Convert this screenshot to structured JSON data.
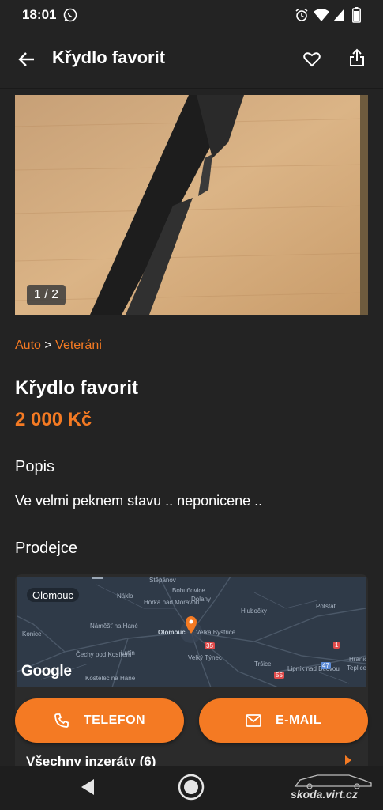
{
  "status_bar": {
    "time": "18:01",
    "battery": "85"
  },
  "app_bar": {
    "title": "Křydlo favorit"
  },
  "gallery": {
    "counter": "1 / 2"
  },
  "breadcrumb": {
    "first": "Auto",
    "separator": ">",
    "second": "Veteráni"
  },
  "ad": {
    "title": "Křydlo favorit",
    "price": "2 000 Kč"
  },
  "description": {
    "heading": "Popis",
    "text": "Ve velmi peknem stavu .. neponicene .."
  },
  "seller": {
    "heading": "Prodejce",
    "map": {
      "city_badge": "Olomouc",
      "attribution": "Google",
      "labels": [
        "Štěpánov",
        "Náklo",
        "Bohuňovice",
        "Horka nad Moravou",
        "Dolany",
        "Hlubočky",
        "Potštát",
        "Náměšť na Hané",
        "Konice",
        "Olomouc",
        "Velká Bystřice",
        "Lutín",
        "Čechy pod Kosířem",
        "Velký Týnec",
        "Tršice",
        "Kostelec na Hané",
        "Lipník nad Bečvou",
        "Hranice",
        "Teplice nad Bečvou",
        "35",
        "55",
        "47",
        "1"
      ]
    },
    "all_ads": "Všechny inzeráty (6)"
  },
  "actions": {
    "phone": "TELEFON",
    "email": "E-MAIL"
  },
  "watermark": "skoda.virt.cz",
  "colors": {
    "accent": "#f47a23",
    "background": "#232323"
  }
}
